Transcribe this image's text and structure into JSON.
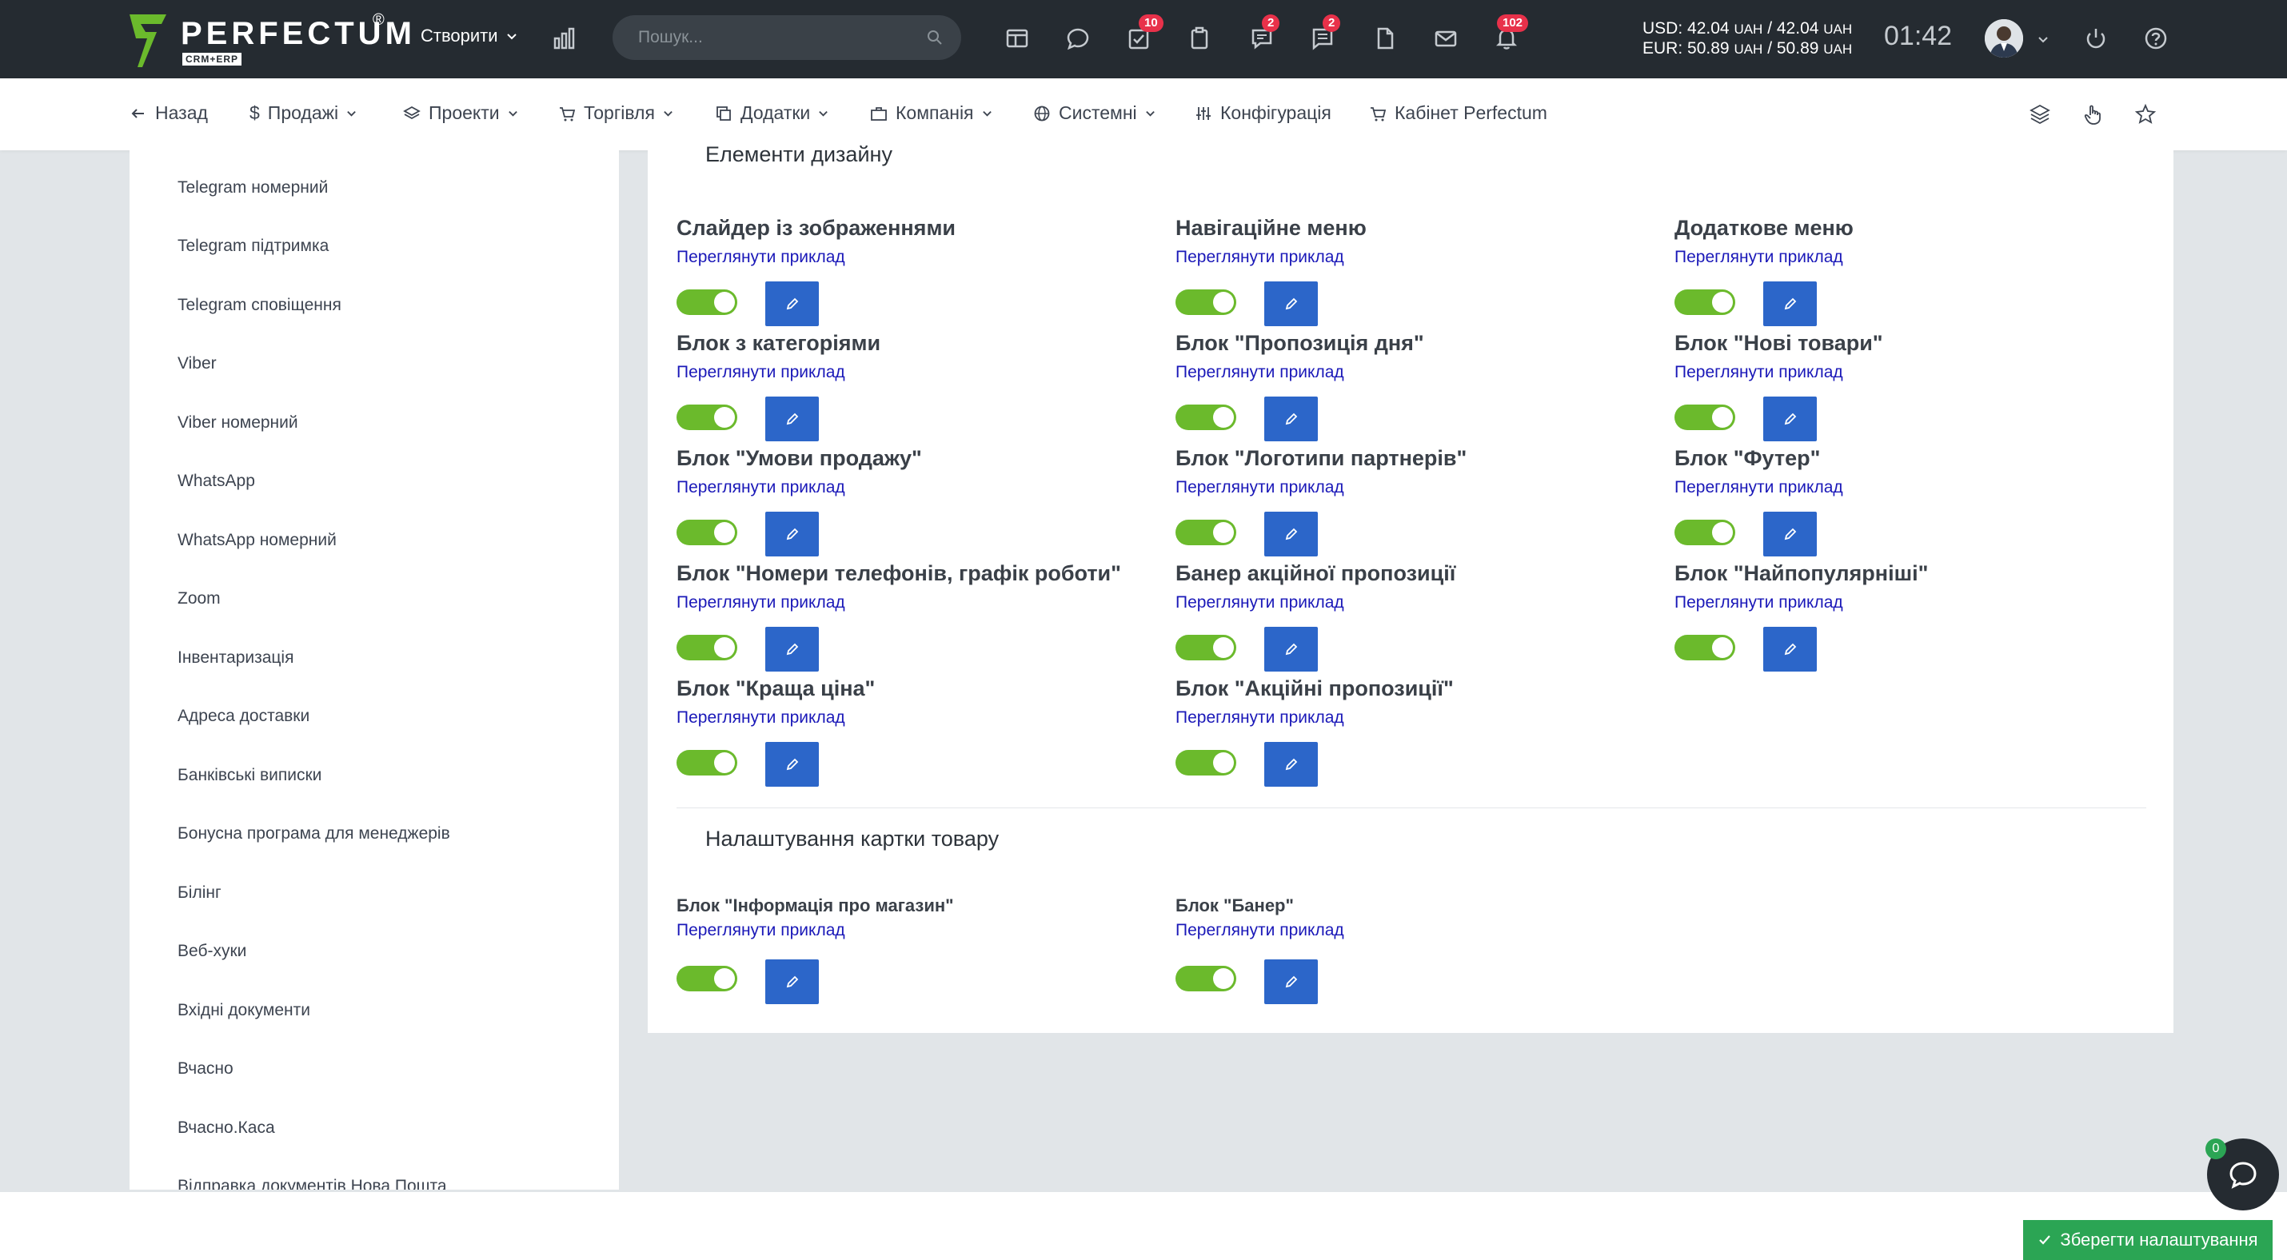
{
  "app": {
    "logo_word": "PERFECTUM",
    "logo_badge": "CRM+ERP",
    "logo_reg": "®"
  },
  "topbar": {
    "create_label": "Створити",
    "search_placeholder": "Пошук...",
    "badges": {
      "tasks": "10",
      "chat": "2",
      "comments": "2",
      "notifications": "102"
    },
    "currency": {
      "usd_label": "USD:",
      "usd_value": "42.04",
      "usd_value2": "42.04",
      "eur_label": "EUR:",
      "eur_value": "50.89",
      "eur_value2": "50.89",
      "unit": "UAH",
      "sep": "/"
    },
    "clock": "01:42"
  },
  "nav": {
    "back": "Назад",
    "sales": "Продажі",
    "projects": "Проекти",
    "trade": "Торгівля",
    "addons": "Додатки",
    "company": "Компанія",
    "system": "Системні",
    "config": "Конфігурація",
    "cabinet": "Кабінет Perfectum"
  },
  "sidebar": {
    "items": [
      "Telegram номерний",
      "Telegram підтримка",
      "Telegram сповіщення",
      "Viber",
      "Viber номерний",
      "WhatsApp",
      "WhatsApp номерний",
      "Zoom",
      "Інвентаризація",
      "Адреса доставки",
      "Банківські виписки",
      "Бонусна програма для менеджерів",
      "Білінг",
      "Веб-хуки",
      "Вхідні документи",
      "Вчасно",
      "Вчасно.Каса",
      "Відправка документів Нова Пошта"
    ]
  },
  "design": {
    "title": "Елементи дизайну",
    "example_link": "Переглянути приклад",
    "blocks": [
      {
        "title": "Слайдер із зображеннями",
        "enabled": true
      },
      {
        "title": "Навігаційне меню",
        "enabled": true
      },
      {
        "title": "Додаткове меню",
        "enabled": true
      },
      {
        "title": "Блок з категоріями",
        "enabled": true
      },
      {
        "title": "Блок \"Пропозиція дня\"",
        "enabled": true
      },
      {
        "title": "Блок \"Нові товари\"",
        "enabled": true
      },
      {
        "title": "Блок \"Умови продажу\"",
        "enabled": true
      },
      {
        "title": "Блок \"Логотипи партнерів\"",
        "enabled": true
      },
      {
        "title": "Блок \"Футер\"",
        "enabled": true
      },
      {
        "title": "Блок \"Номери телефонів, графік роботи\"",
        "enabled": true
      },
      {
        "title": "Банер акційної пропозиції",
        "enabled": true
      },
      {
        "title": "Блок \"Найпопулярніші\"",
        "enabled": true
      },
      {
        "title": "Блок \"Краща ціна\"",
        "enabled": true
      },
      {
        "title": "Блок \"Акційні пропозиції\"",
        "enabled": true
      }
    ]
  },
  "product_card": {
    "title": "Налаштування картки товару",
    "blocks": [
      {
        "title": "Блок \"Інформація про магазин\"",
        "enabled": true
      },
      {
        "title": "Блок \"Банер\"",
        "enabled": true
      }
    ]
  },
  "footer": {
    "save_label": "Зберегти налаштування",
    "chat_count": "0"
  },
  "colors": {
    "topbar": "#252b31",
    "accent_blue": "#2c66c9",
    "toggle_on": "#6bba2c",
    "save_green": "#2ba554",
    "badge_red": "#e8314a",
    "link": "#1a18b8"
  }
}
